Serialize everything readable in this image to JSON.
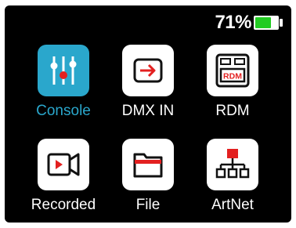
{
  "status": {
    "battery_percent_text": "71%",
    "battery_level": 0.71,
    "battery_color": "#22cc22"
  },
  "menu": {
    "selected_color": "#2aa7cc",
    "items": [
      {
        "label": "Console",
        "icon": "console-sliders-icon",
        "selected": true
      },
      {
        "label": "DMX IN",
        "icon": "dmx-in-icon",
        "selected": false
      },
      {
        "label": "RDM",
        "icon": "rdm-icon",
        "selected": false
      },
      {
        "label": "Recorded",
        "icon": "recorded-camera-icon",
        "selected": false
      },
      {
        "label": "File",
        "icon": "folder-icon",
        "selected": false
      },
      {
        "label": "ArtNet",
        "icon": "artnet-network-icon",
        "selected": false
      }
    ]
  }
}
